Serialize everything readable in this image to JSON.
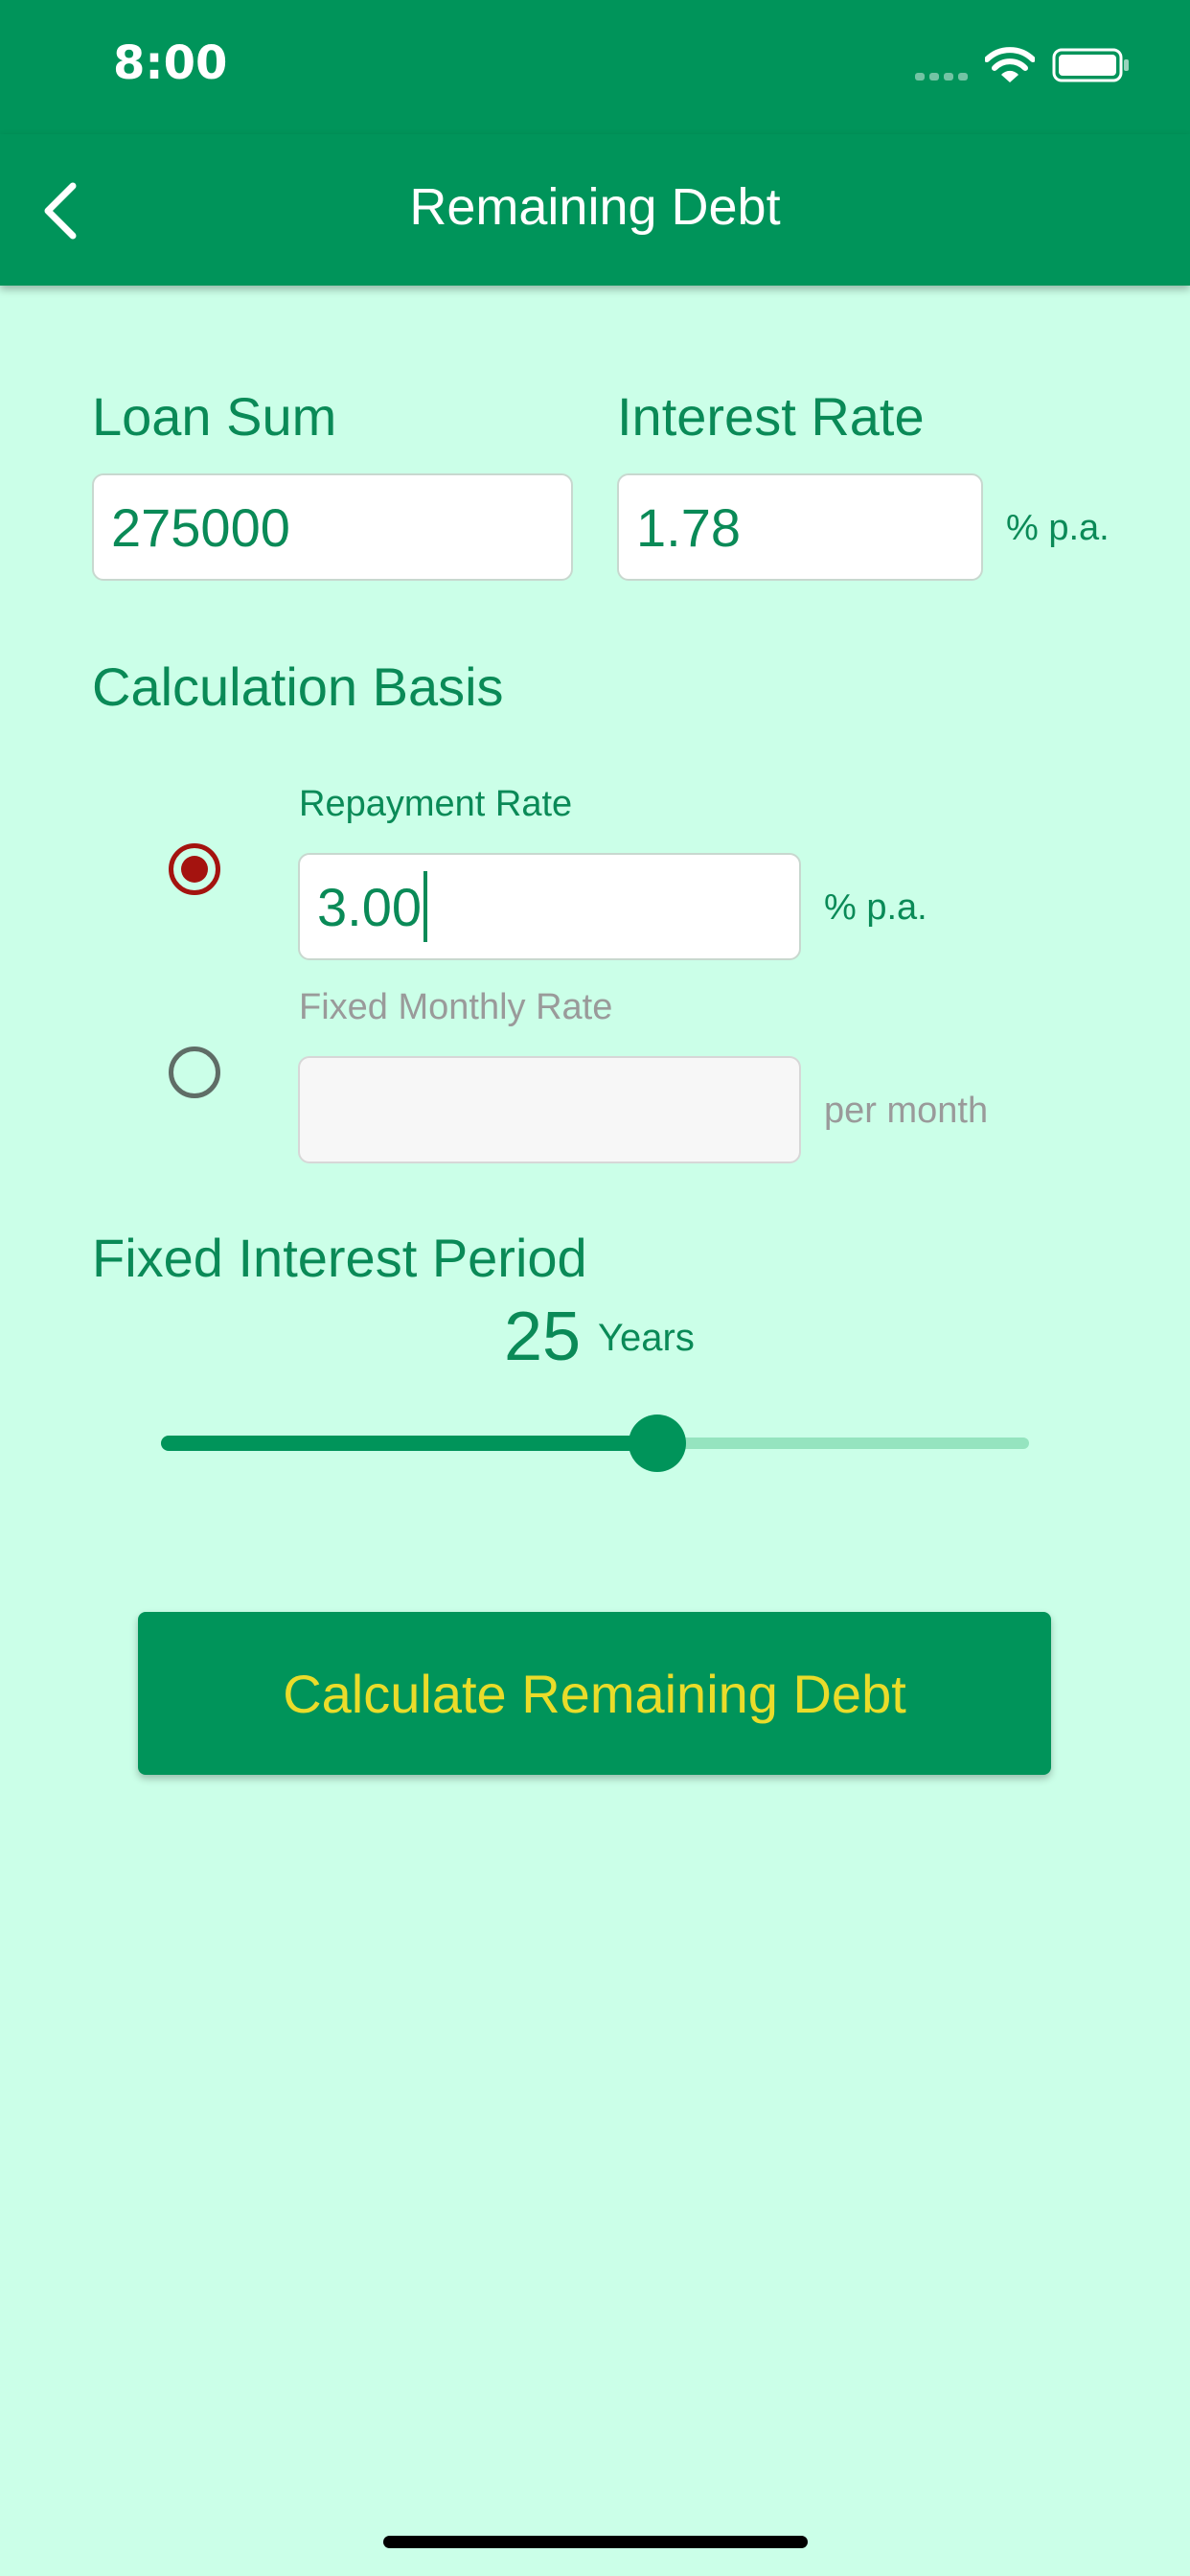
{
  "status_bar": {
    "time": "8:00"
  },
  "nav": {
    "title": "Remaining Debt",
    "back_icon": "chevron-left-icon"
  },
  "loan_sum": {
    "label": "Loan Sum",
    "value": "275000"
  },
  "interest_rate": {
    "label": "Interest Rate",
    "value": "1.78",
    "unit": "% p.a."
  },
  "calculation_basis": {
    "label": "Calculation Basis",
    "repayment_rate": {
      "label": "Repayment Rate",
      "value": "3.00",
      "unit": "% p.a.",
      "selected": true
    },
    "fixed_monthly_rate": {
      "label": "Fixed Monthly Rate",
      "value": "",
      "unit": "per month",
      "selected": false
    }
  },
  "fixed_interest_period": {
    "label": "Fixed Interest Period",
    "value": "25",
    "unit": "Years",
    "slider_fraction": 0.572
  },
  "calculate_button": {
    "label": "Calculate Remaining Debt"
  },
  "colors": {
    "primary": "#00945a",
    "background": "#cbffe8",
    "text": "#0a8a57",
    "button_text": "#eadc2a",
    "radio_selected": "#a4130f"
  }
}
